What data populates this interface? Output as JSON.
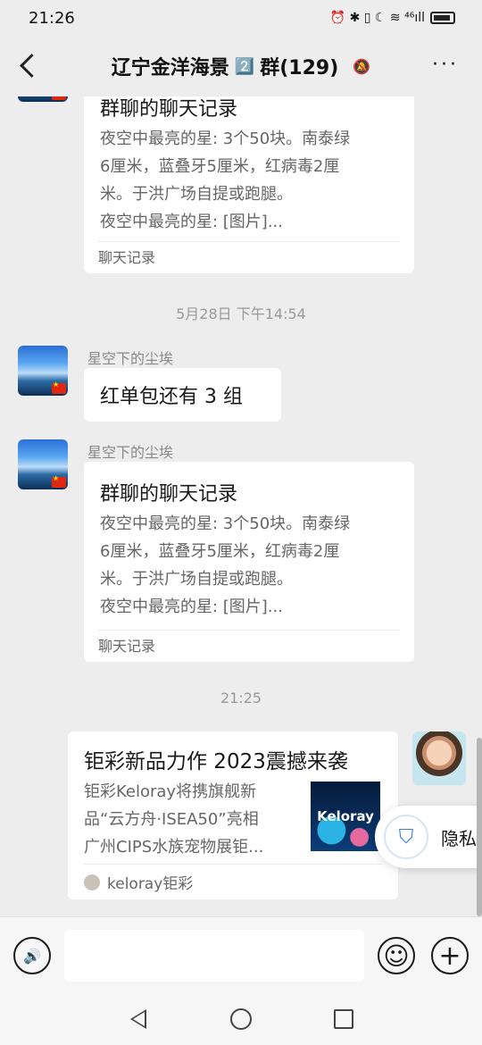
{
  "status": {
    "time": "21:26",
    "icons": "⏰ ✱ ▯ ☾ ≋ ⁴⁶ıll"
  },
  "nav": {
    "title": "辽宁金洋海景",
    "badge": "2️⃣",
    "suffix": "群(129)",
    "mute_icon": "🔕",
    "more": "···"
  },
  "messages": {
    "m1": {
      "title": "群聊的聊天记录",
      "lines": [
        "夜空中最亮的星: 3个50块。南泰绿",
        "6厘米，蓝叠牙5厘米，红病毒2厘",
        "米。于洪广场自提或跑腿。",
        "夜空中最亮的星: [图片]..."
      ],
      "footer": "聊天记录"
    },
    "time1": "5月28日 下午14:54",
    "m2": {
      "sender": "星空下的尘埃",
      "text": "红单包还有 3 组"
    },
    "m3": {
      "sender": "星空下的尘埃",
      "title": "群聊的聊天记录",
      "lines": [
        "夜空中最亮的星: 3个50块。南泰绿",
        "6厘米，蓝叠牙5厘米，红病毒2厘",
        "米。于洪广场自提或跑腿。",
        "夜空中最亮的星: [图片]..."
      ],
      "footer": "聊天记录"
    },
    "time2": "21:25",
    "m4": {
      "title": "钜彩新品力作 2023震撼来袭",
      "lines": [
        "钜彩Keloray将携旗舰新",
        "品“云方舟·ISEA50”亮相",
        "广州CIPS水族宠物展钜..."
      ],
      "thumb_text": "Keloray",
      "source": "keloray钜彩"
    }
  },
  "privacy": {
    "label": "隐私"
  },
  "input": {
    "voice_icon": "🔊",
    "emoji_icon": "☺",
    "plus_icon": "+"
  }
}
